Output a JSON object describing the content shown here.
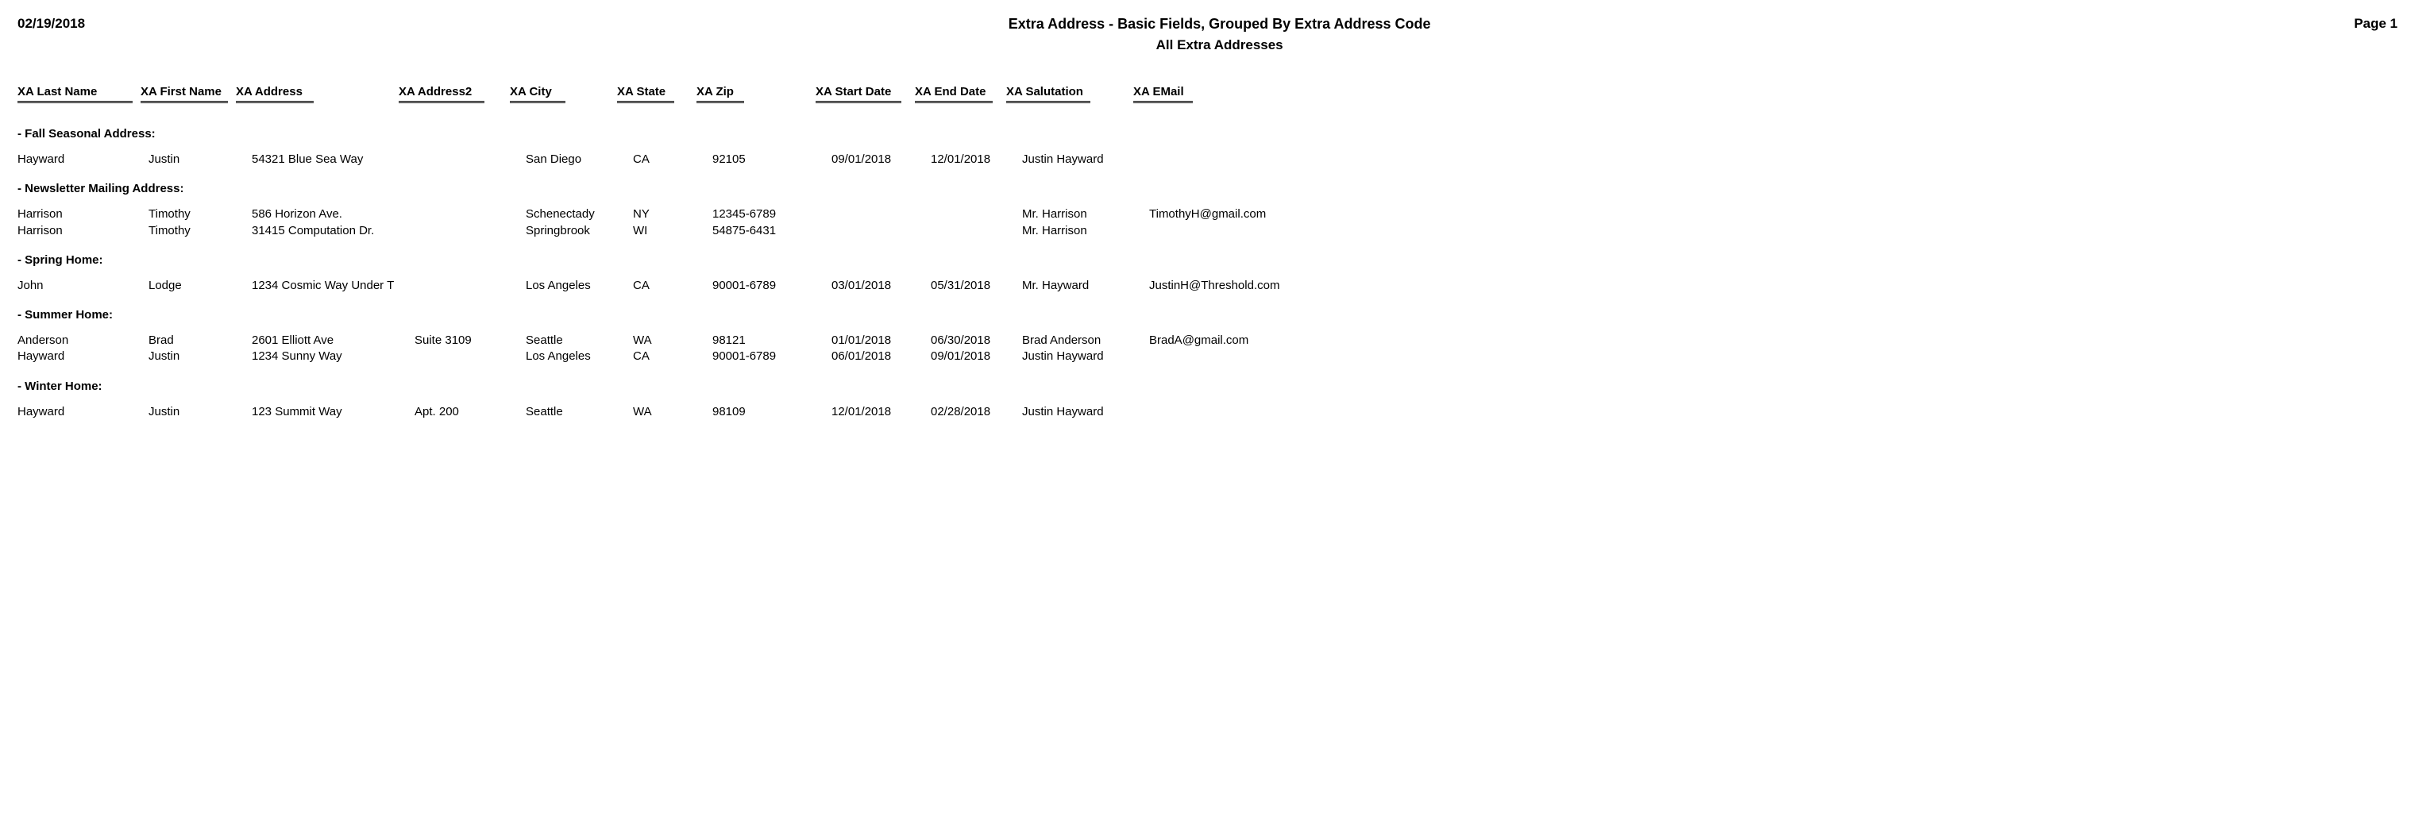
{
  "report": {
    "date": "02/19/2018",
    "title": "Extra Address - Basic Fields, Grouped By Extra Address Code",
    "subtitle": "All Extra Addresses",
    "page_label": "Page 1"
  },
  "columns": {
    "last": "XA Last Name",
    "first": "XA First Name",
    "addr": "XA Address",
    "addr2": "XA Address2",
    "city": "XA City",
    "state": "XA State",
    "zip": "XA Zip",
    "start": "XA Start Date",
    "end": "XA End Date",
    "salut": "XA Salutation",
    "email": "XA EMail"
  },
  "groups": [
    {
      "label": "- Fall Seasonal Address:",
      "rows": [
        {
          "last": "Hayward",
          "first": "Justin",
          "addr": "54321 Blue Sea Way",
          "addr2": "",
          "city": "San Diego",
          "state": "CA",
          "zip": "92105",
          "start": "09/01/2018",
          "end": "12/01/2018",
          "salut": "Justin Hayward",
          "email": ""
        }
      ]
    },
    {
      "label": "- Newsletter Mailing Address:",
      "rows": [
        {
          "last": "Harrison",
          "first": "Timothy",
          "addr": "586 Horizon Ave.",
          "addr2": "",
          "city": "Schenectady",
          "state": "NY",
          "zip": "12345-6789",
          "start": "",
          "end": "",
          "salut": "Mr. Harrison",
          "email": "TimothyH@gmail.com"
        },
        {
          "last": "Harrison",
          "first": "Timothy",
          "addr": "31415 Computation Dr.",
          "addr2": "",
          "city": "Springbrook",
          "state": "WI",
          "zip": "54875-6431",
          "start": "",
          "end": "",
          "salut": "Mr. Harrison",
          "email": ""
        }
      ]
    },
    {
      "label": "- Spring Home:",
      "rows": [
        {
          "last": "John",
          "first": "Lodge",
          "addr": "1234 Cosmic Way Under T",
          "addr2": "",
          "city": "Los Angeles",
          "state": "CA",
          "zip": "90001-6789",
          "start": "03/01/2018",
          "end": "05/31/2018",
          "salut": "Mr. Hayward",
          "email": "JustinH@Threshold.com"
        }
      ]
    },
    {
      "label": "- Summer Home:",
      "rows": [
        {
          "last": "Anderson",
          "first": "Brad",
          "addr": "2601 Elliott Ave",
          "addr2": "Suite 3109",
          "city": "Seattle",
          "state": "WA",
          "zip": "98121",
          "start": "01/01/2018",
          "end": "06/30/2018",
          "salut": "Brad Anderson",
          "email": "BradA@gmail.com"
        },
        {
          "last": "Hayward",
          "first": "Justin",
          "addr": "1234 Sunny Way",
          "addr2": "",
          "city": "Los Angeles",
          "state": "CA",
          "zip": "90001-6789",
          "start": "06/01/2018",
          "end": "09/01/2018",
          "salut": "Justin Hayward",
          "email": ""
        }
      ]
    },
    {
      "label": "- Winter Home:",
      "rows": [
        {
          "last": "Hayward",
          "first": "Justin",
          "addr": "123 Summit Way",
          "addr2": "Apt. 200",
          "city": "Seattle",
          "state": "WA",
          "zip": "98109",
          "start": "12/01/2018",
          "end": "02/28/2018",
          "salut": "Justin Hayward",
          "email": ""
        }
      ]
    }
  ]
}
